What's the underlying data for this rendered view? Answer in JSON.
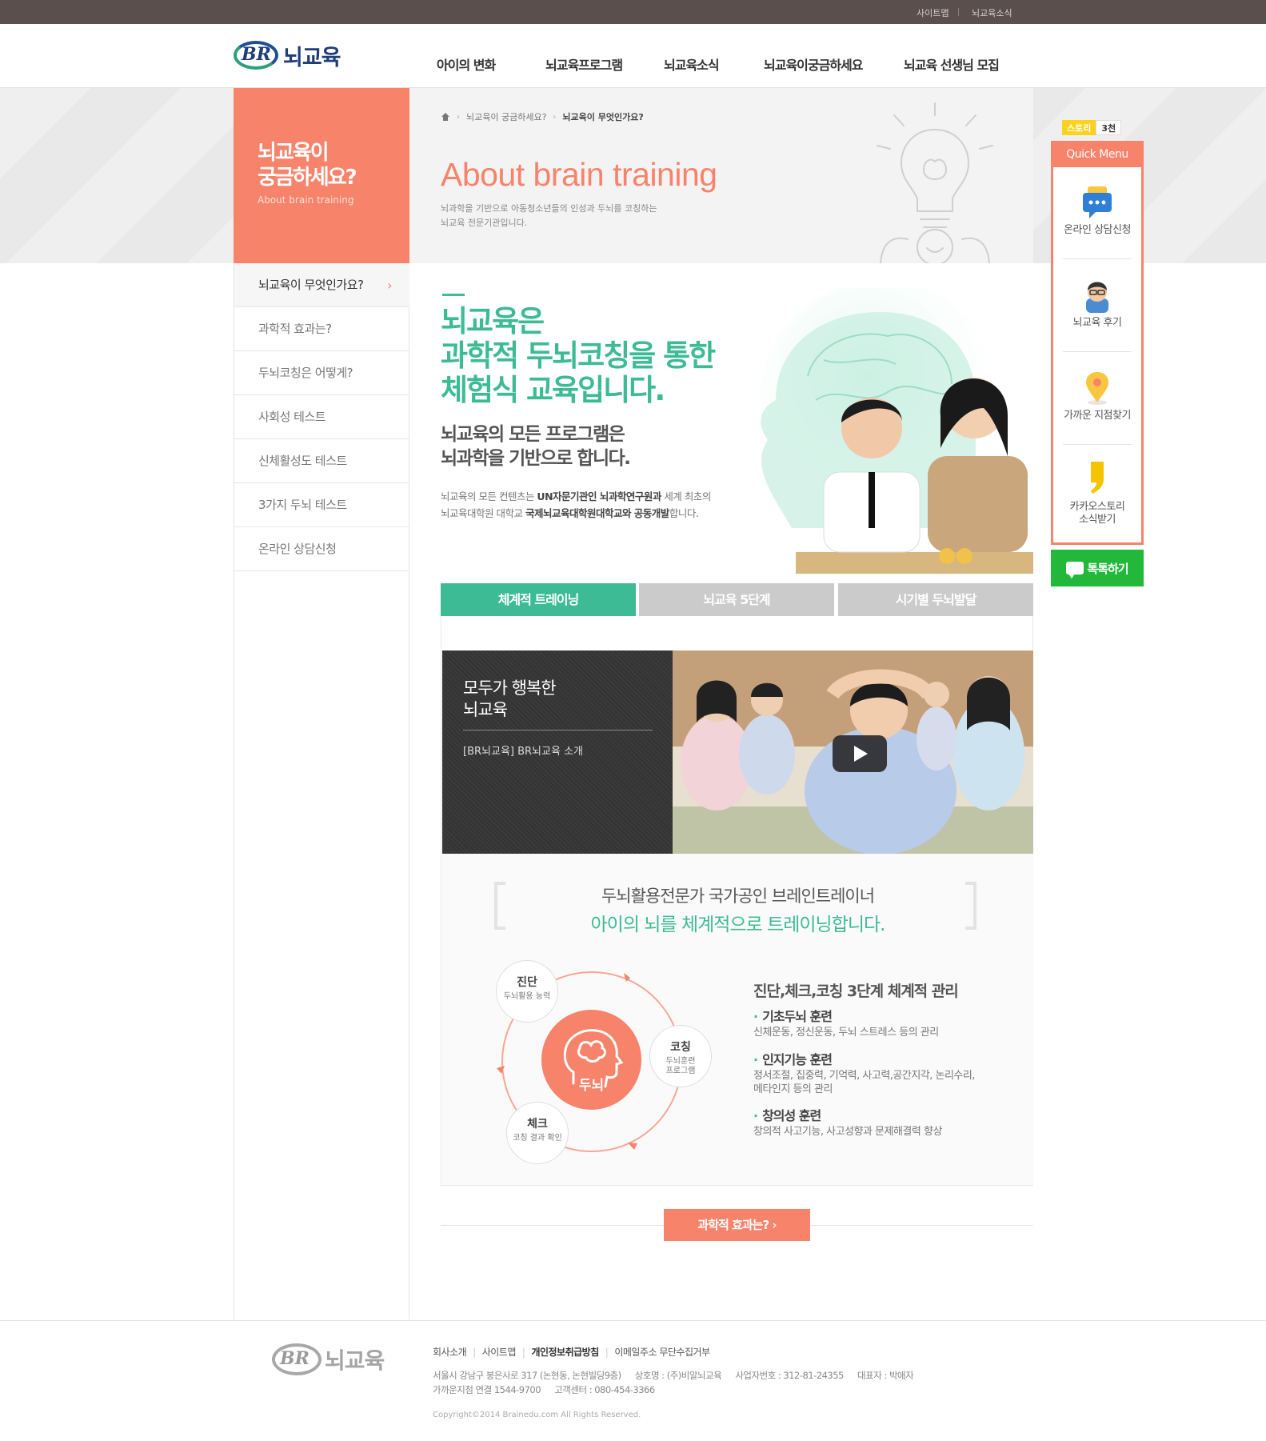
{
  "util": {
    "sitemap": "사이트맵",
    "news": "뇌교육소식"
  },
  "brand": {
    "mark": "BR",
    "name": "뇌교육"
  },
  "gnb": [
    "아이의 변화",
    "뇌교육프로그램",
    "뇌교육소식",
    "뇌교육이궁금하세요",
    "뇌교육 선생님 모집"
  ],
  "side_title": {
    "ko_line1": "뇌교육이",
    "ko_line2": "궁금하세요?",
    "en": "About brain training"
  },
  "breadcrumb": [
    "뇌교육이 궁금하세요?",
    "뇌교육이 무엇인가요?"
  ],
  "visual": {
    "title_en": "About brain training",
    "desc_line1": "뇌과학을 기반으로 아동청소년들의 인성과 두뇌를 코칭하는",
    "desc_line2": "뇌교육 전문기관입니다."
  },
  "lnb": [
    "뇌교육이 무엇인가요?",
    "과학적 효과는?",
    "두뇌코칭은 어떻게?",
    "사회성 테스트",
    "신체활성도 테스트",
    "3가지 두뇌 테스트",
    "온라인 상담신청"
  ],
  "intro": {
    "h1_line1": "뇌교육은",
    "h1_line2": "과학적 두뇌코칭을 통한",
    "h1_line3": "체험식 교육입니다.",
    "h2_line1": "뇌교육의 모든 프로그램은",
    "h2_line2": "뇌과학을 기반으로 합니다.",
    "desc_a": "뇌교육의 모든 컨텐츠는 ",
    "desc_b": "UN자문기관인 뇌과학연구원과",
    "desc_c": " 세계 최초의",
    "desc_d": "뇌교육대학원 대학교 ",
    "desc_e": "국제뇌교육대학원대학교와 공동개발",
    "desc_f": "합니다."
  },
  "tabs": [
    "체계적 트레이닝",
    "뇌교육 5단계",
    "시기별 두뇌발달"
  ],
  "video": {
    "title_line1": "모두가 행복한",
    "title_line2": "뇌교육",
    "subtitle": "[BR뇌교육] BR뇌교육 소개"
  },
  "message": {
    "line1": "두뇌활용전문가 국가공인 브레인트레이너",
    "line2": "아이의 뇌를 체계적으로 트레이닝합니다."
  },
  "cycle": {
    "core": "두뇌",
    "diag": {
      "title": "진단",
      "sub": "두뇌활용 능력"
    },
    "coach": {
      "title": "코칭",
      "sub1": "두뇌훈련",
      "sub2": "프로그램"
    },
    "check": {
      "title": "체크",
      "sub": "코칭 결과 확인"
    }
  },
  "management": {
    "title": "진단,체크,코칭 3단계 체계적 관리",
    "items": [
      {
        "title": "기초두뇌 훈련",
        "line1": "신체운동, 정신운동, 두뇌 스트레스 등의 관리",
        "line2": ""
      },
      {
        "title": "인지기능 훈련",
        "line1": "정서조절, 집중력, 기억력, 사고력,공간지각, 논리수리,",
        "line2": "메타인지 등의 관리"
      },
      {
        "title": "창의성 훈련",
        "line1": "창의적 사고기능, 사고성향과 문제해결력 향상",
        "line2": ""
      }
    ]
  },
  "next_button": "과학적 효과는? ›",
  "quick": {
    "story_label": "스토리",
    "story_count": "3천",
    "header": "Quick Menu",
    "items": [
      "온라인 상담신청",
      "뇌교육 후기",
      "가까운 지점찾기",
      "카카오스토리",
      "소식받기"
    ],
    "talk": "톡톡하기"
  },
  "footer": {
    "links": [
      "회사소개",
      "사이트맵",
      "개인정보취급방침",
      "이메일주소 무단수집거부"
    ],
    "addr": "서울시 강남구 봉은사로 317 (논현동, 논현빌딩9층)",
    "company": "상호명 : (주)비알뇌교육",
    "bizno": "사업자번호 : 312-81-24355",
    "ceo": "대표자 : 박애자",
    "phone": "가까운지점 연결 1544-9700",
    "cs": "고객센터 : 080-454-3366",
    "copyright": "Copyright©2014 Brainedu.com All Rights Reserved."
  },
  "colors": {
    "accent": "#f7836a",
    "green": "#3dbb94",
    "dark": "#5a4f4d",
    "talk": "#22b83a"
  }
}
